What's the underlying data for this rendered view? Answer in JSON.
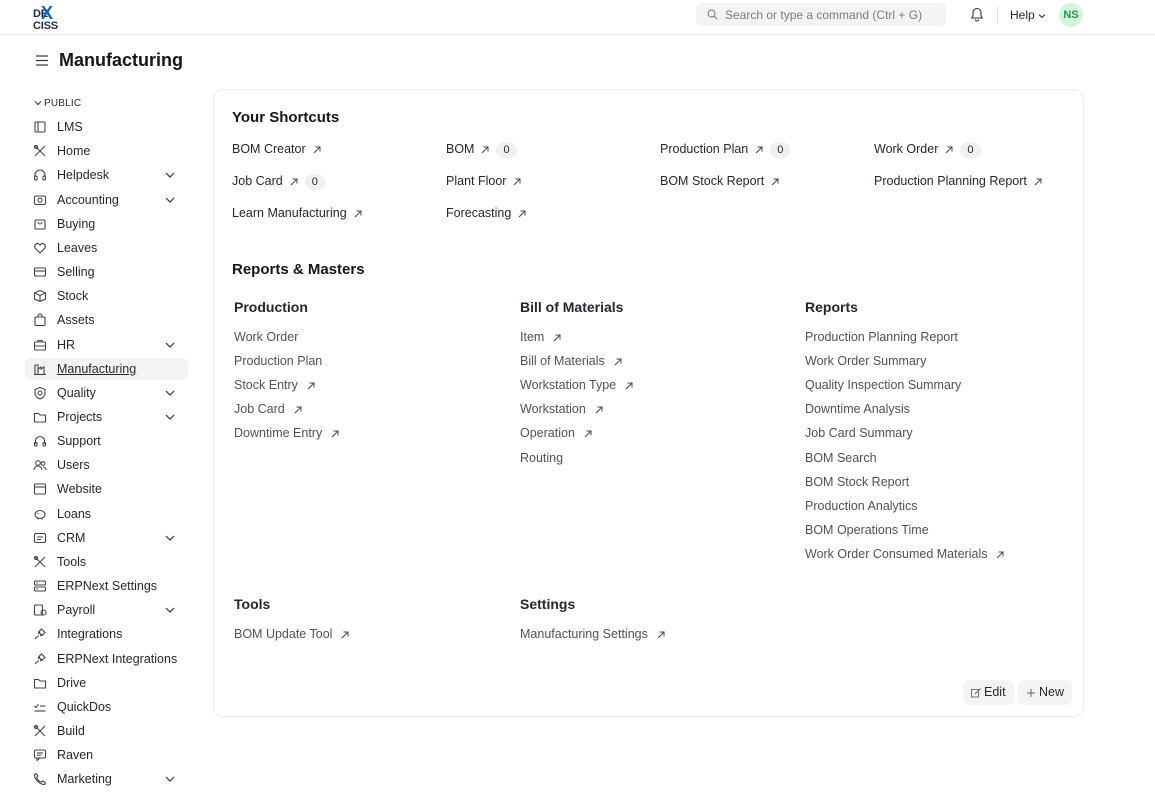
{
  "navbar": {
    "logo_prefix": "DE",
    "logo_x": "X",
    "logo_suffix": "CISS",
    "search_placeholder": "Search or type a command (Ctrl + G)",
    "help_label": "Help",
    "avatar_initials": "NS"
  },
  "page": {
    "title": "Manufacturing"
  },
  "sidebar": {
    "section_label": "PUBLIC",
    "items": [
      {
        "label": "LMS",
        "icon": "book-icon",
        "chevron": false
      },
      {
        "label": "Home",
        "icon": "tools-icon",
        "chevron": false
      },
      {
        "label": "Helpdesk",
        "icon": "headset-icon",
        "chevron": true
      },
      {
        "label": "Accounting",
        "icon": "wallet-icon",
        "chevron": true
      },
      {
        "label": "Buying",
        "icon": "cart-icon",
        "chevron": false
      },
      {
        "label": "Leaves",
        "icon": "heart-icon",
        "chevron": false
      },
      {
        "label": "Selling",
        "icon": "card-icon",
        "chevron": false
      },
      {
        "label": "Stock",
        "icon": "box-icon",
        "chevron": false
      },
      {
        "label": "Assets",
        "icon": "bag-icon",
        "chevron": false
      },
      {
        "label": "HR",
        "icon": "briefcase-icon",
        "chevron": true
      },
      {
        "label": "Manufacturing",
        "icon": "factory-icon",
        "chevron": false,
        "active": true
      },
      {
        "label": "Quality",
        "icon": "shield-icon",
        "chevron": true
      },
      {
        "label": "Projects",
        "icon": "folder-icon",
        "chevron": true
      },
      {
        "label": "Support",
        "icon": "headphones-icon",
        "chevron": false
      },
      {
        "label": "Users",
        "icon": "users-icon",
        "chevron": false
      },
      {
        "label": "Website",
        "icon": "browser-icon",
        "chevron": false
      },
      {
        "label": "Loans",
        "icon": "piggy-icon",
        "chevron": false
      },
      {
        "label": "CRM",
        "icon": "crm-icon",
        "chevron": true
      },
      {
        "label": "Tools",
        "icon": "tools-icon",
        "chevron": false
      },
      {
        "label": "ERPNext Settings",
        "icon": "sliders-icon",
        "chevron": false
      },
      {
        "label": "Payroll",
        "icon": "payroll-icon",
        "chevron": true
      },
      {
        "label": "Integrations",
        "icon": "plug-icon",
        "chevron": false
      },
      {
        "label": "ERPNext Integrations",
        "icon": "plug-icon",
        "chevron": false
      },
      {
        "label": "Drive",
        "icon": "folder-icon",
        "chevron": false
      },
      {
        "label": "QuickDos",
        "icon": "checklist-icon",
        "chevron": false
      },
      {
        "label": "Build",
        "icon": "tools-icon",
        "chevron": false
      },
      {
        "label": "Raven",
        "icon": "chat-icon",
        "chevron": false
      },
      {
        "label": "Marketing",
        "icon": "phone-icon",
        "chevron": true
      }
    ]
  },
  "shortcuts": {
    "heading": "Your Shortcuts",
    "items": [
      {
        "label": "BOM Creator",
        "count": null
      },
      {
        "label": "BOM",
        "count": "0"
      },
      {
        "label": "Production Plan",
        "count": "0"
      },
      {
        "label": "Work Order",
        "count": "0"
      },
      {
        "label": "Job Card",
        "count": "0"
      },
      {
        "label": "Plant Floor",
        "count": null
      },
      {
        "label": "BOM Stock Report",
        "count": null
      },
      {
        "label": "Production Planning Report",
        "count": null
      },
      {
        "label": "Learn Manufacturing",
        "count": null
      },
      {
        "label": "Forecasting",
        "count": null
      }
    ]
  },
  "reports": {
    "heading": "Reports & Masters",
    "columns": [
      {
        "title": "Production",
        "links": [
          {
            "label": "Work Order",
            "arrow": false
          },
          {
            "label": "Production Plan",
            "arrow": false
          },
          {
            "label": "Stock Entry",
            "arrow": true
          },
          {
            "label": "Job Card",
            "arrow": true
          },
          {
            "label": "Downtime Entry",
            "arrow": true
          }
        ]
      },
      {
        "title": "Bill of Materials",
        "links": [
          {
            "label": "Item",
            "arrow": true
          },
          {
            "label": "Bill of Materials",
            "arrow": true
          },
          {
            "label": "Workstation Type",
            "arrow": true
          },
          {
            "label": "Workstation",
            "arrow": true
          },
          {
            "label": "Operation",
            "arrow": true
          },
          {
            "label": "Routing",
            "arrow": false
          }
        ]
      },
      {
        "title": "Reports",
        "links": [
          {
            "label": "Production Planning Report",
            "arrow": false
          },
          {
            "label": "Work Order Summary",
            "arrow": false
          },
          {
            "label": "Quality Inspection Summary",
            "arrow": false
          },
          {
            "label": "Downtime Analysis",
            "arrow": false
          },
          {
            "label": "Job Card Summary",
            "arrow": false
          },
          {
            "label": "BOM Search",
            "arrow": false
          },
          {
            "label": "BOM Stock Report",
            "arrow": false
          },
          {
            "label": "Production Analytics",
            "arrow": false
          },
          {
            "label": "BOM Operations Time",
            "arrow": false
          },
          {
            "label": "Work Order Consumed Materials",
            "arrow": true
          }
        ]
      },
      {
        "title": "Tools",
        "links": [
          {
            "label": "BOM Update Tool",
            "arrow": true
          }
        ]
      },
      {
        "title": "Settings",
        "links": [
          {
            "label": "Manufacturing Settings",
            "arrow": true
          }
        ]
      }
    ]
  },
  "actions": {
    "edit_label": "Edit",
    "new_label": "New"
  }
}
